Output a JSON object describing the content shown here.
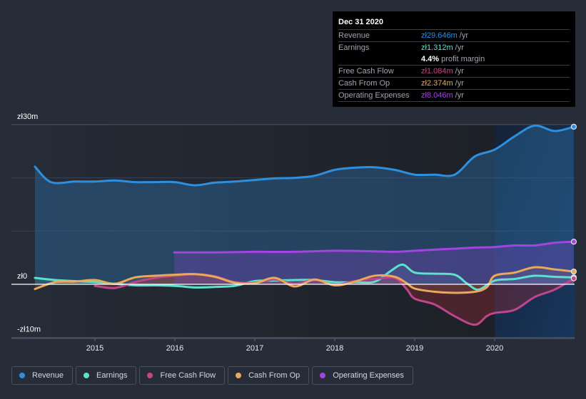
{
  "tooltip": {
    "date": "Dec 31 2020",
    "rows": [
      {
        "label": "Revenue",
        "value": "zł29.646m",
        "unit": "/yr",
        "color": "#2d8fde"
      },
      {
        "label": "Earnings",
        "value": "zł1.312m",
        "unit": "/yr",
        "color": "#5ee0cf"
      },
      {
        "label": "",
        "value": "4.4%",
        "unit": "profit margin",
        "color": "#ffffff"
      },
      {
        "label": "Free Cash Flow",
        "value": "zł1.084m",
        "unit": "/yr",
        "color": "#c0458a"
      },
      {
        "label": "Cash From Op",
        "value": "zł2.374m",
        "unit": "/yr",
        "color": "#e8a95b"
      },
      {
        "label": "Operating Expenses",
        "value": "zł8.046m",
        "unit": "/yr",
        "color": "#a244e0"
      }
    ]
  },
  "legend": [
    {
      "label": "Revenue",
      "color": "#2d8fde"
    },
    {
      "label": "Earnings",
      "color": "#5ee0cf"
    },
    {
      "label": "Free Cash Flow",
      "color": "#c0458a"
    },
    {
      "label": "Cash From Op",
      "color": "#e8a95b"
    },
    {
      "label": "Operating Expenses",
      "color": "#a244e0"
    }
  ],
  "chart_data": {
    "type": "area",
    "title": "",
    "xlabel": "",
    "ylabel": "",
    "x_ticks": [
      "2015",
      "2016",
      "2017",
      "2018",
      "2019",
      "2020"
    ],
    "y_ticks": [
      {
        "value": 30,
        "label": "zł30m"
      },
      {
        "value": 0,
        "label": "zł0"
      },
      {
        "value": -10,
        "label": "-zł10m"
      }
    ],
    "xlim": [
      2014.15,
      2021.0
    ],
    "ylim": [
      -10,
      30
    ],
    "grid": true,
    "legend_position": "bottom-left",
    "highlight_range": [
      2020.0,
      2021.0
    ],
    "series": [
      {
        "name": "Revenue",
        "color": "#2d8fde",
        "x": [
          2014.25,
          2014.45,
          2014.75,
          2015.0,
          2015.25,
          2015.5,
          2015.75,
          2016.0,
          2016.25,
          2016.5,
          2016.75,
          2017.0,
          2017.25,
          2017.5,
          2017.75,
          2018.0,
          2018.25,
          2018.5,
          2018.75,
          2019.0,
          2019.25,
          2019.5,
          2019.75,
          2020.0,
          2020.25,
          2020.5,
          2020.75,
          2020.99
        ],
        "y": [
          22.1,
          19.2,
          19.3,
          19.3,
          19.5,
          19.2,
          19.2,
          19.2,
          18.6,
          19.1,
          19.3,
          19.6,
          19.9,
          20.0,
          20.4,
          21.5,
          21.9,
          22.0,
          21.5,
          20.6,
          20.6,
          20.6,
          24.0,
          25.3,
          27.8,
          29.8,
          28.8,
          29.6
        ]
      },
      {
        "name": "Earnings",
        "color": "#5ee0cf",
        "x": [
          2014.25,
          2014.5,
          2014.75,
          2015.0,
          2015.25,
          2015.5,
          2015.75,
          2016.0,
          2016.25,
          2016.5,
          2016.75,
          2017.0,
          2017.25,
          2017.5,
          2017.75,
          2018.0,
          2018.25,
          2018.5,
          2018.7,
          2018.85,
          2019.0,
          2019.25,
          2019.5,
          2019.65,
          2019.8,
          2020.0,
          2020.25,
          2020.5,
          2020.75,
          2020.99
        ],
        "y": [
          1.2,
          0.8,
          0.6,
          0.4,
          0.1,
          -0.2,
          -0.2,
          -0.3,
          -0.6,
          -0.5,
          -0.3,
          0.6,
          0.7,
          0.8,
          0.8,
          0.4,
          0.4,
          0.5,
          2.5,
          3.7,
          2.2,
          2.0,
          1.8,
          0.2,
          -1.0,
          0.7,
          1.0,
          1.6,
          1.4,
          1.3
        ]
      },
      {
        "name": "Free Cash Flow",
        "color": "#c0458a",
        "x": [
          2015.0,
          2015.25,
          2015.5,
          2015.75,
          2016.0,
          2016.25,
          2016.5,
          2016.75,
          2017.0,
          2017.25,
          2017.5,
          2017.75,
          2018.0,
          2018.25,
          2018.5,
          2018.75,
          2018.9,
          2019.0,
          2019.25,
          2019.5,
          2019.75,
          2019.9,
          2020.0,
          2020.25,
          2020.5,
          2020.75,
          2020.99
        ],
        "y": [
          -0.3,
          -0.7,
          0.4,
          1.2,
          1.6,
          1.9,
          1.5,
          0.4,
          0.3,
          0.9,
          0.1,
          0.8,
          -0.1,
          0.6,
          1.0,
          1.2,
          -0.9,
          -2.7,
          -3.8,
          -6.0,
          -7.6,
          -6.0,
          -5.4,
          -4.8,
          -2.4,
          -1.0,
          1.1
        ]
      },
      {
        "name": "Cash From Op",
        "color": "#e8a95b",
        "x": [
          2014.25,
          2014.5,
          2014.75,
          2015.0,
          2015.25,
          2015.5,
          2015.75,
          2016.0,
          2016.25,
          2016.5,
          2016.75,
          2017.0,
          2017.25,
          2017.5,
          2017.75,
          2018.0,
          2018.25,
          2018.5,
          2018.75,
          2018.9,
          2019.0,
          2019.25,
          2019.5,
          2019.75,
          2019.9,
          2020.0,
          2020.25,
          2020.5,
          2020.75,
          2020.99
        ],
        "y": [
          -0.9,
          0.4,
          0.5,
          0.8,
          0.1,
          1.3,
          1.6,
          1.8,
          1.9,
          1.4,
          0.3,
          0.2,
          1.2,
          -0.4,
          0.9,
          -0.2,
          0.5,
          1.6,
          1.4,
          0.2,
          -0.8,
          -1.4,
          -1.6,
          -1.4,
          -0.6,
          1.6,
          2.2,
          3.2,
          2.8,
          2.4
        ]
      },
      {
        "name": "Operating Expenses",
        "color": "#a244e0",
        "x": [
          2015.99,
          2016.5,
          2017.0,
          2017.5,
          2018.0,
          2018.5,
          2018.75,
          2019.0,
          2019.25,
          2019.5,
          2019.75,
          2020.0,
          2020.25,
          2020.5,
          2020.75,
          2020.99
        ],
        "y": [
          6.0,
          6.0,
          6.1,
          6.1,
          6.3,
          6.2,
          6.1,
          6.3,
          6.5,
          6.7,
          6.9,
          7.0,
          7.3,
          7.3,
          7.8,
          8.0
        ]
      }
    ]
  }
}
